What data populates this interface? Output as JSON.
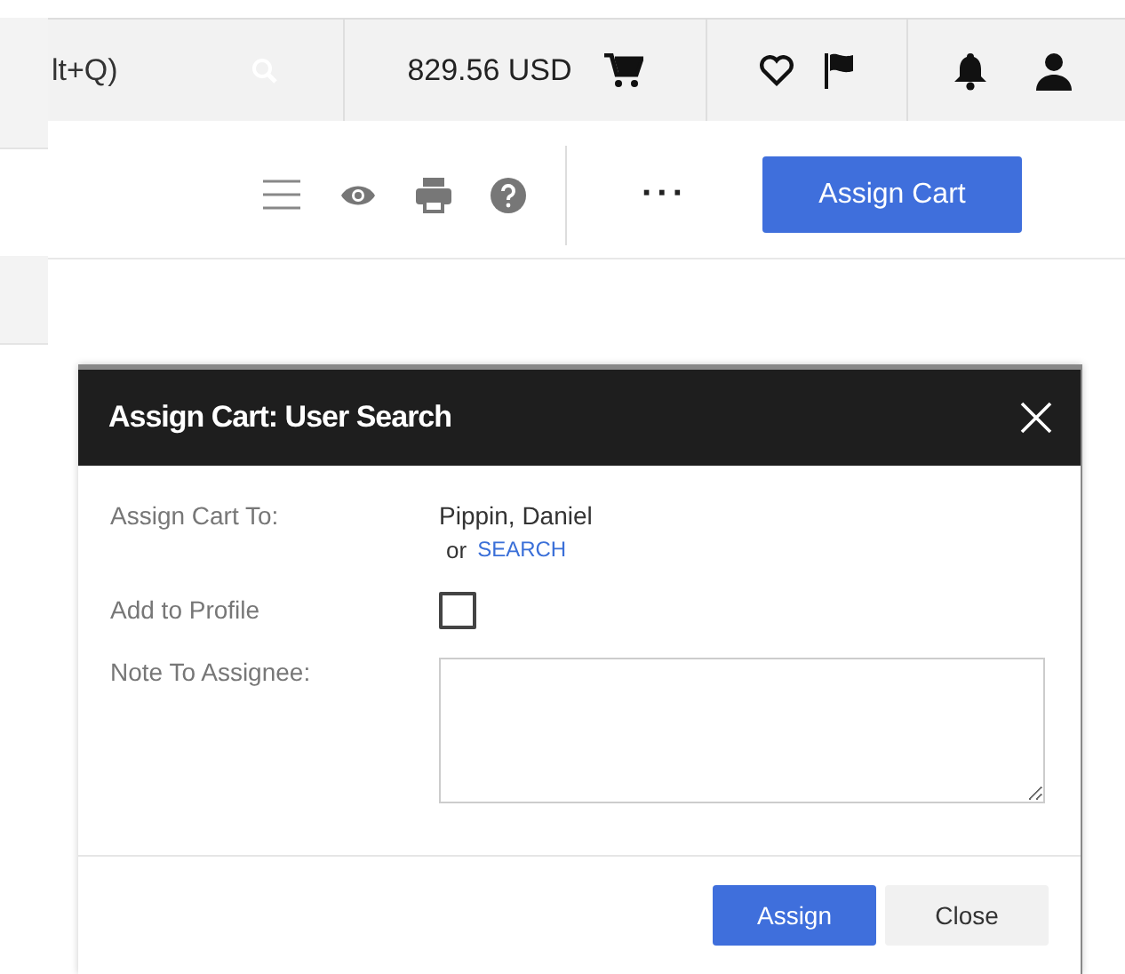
{
  "header": {
    "search_hint": "lt+Q)",
    "cart_total": "829.56 USD"
  },
  "toolbar": {
    "more": "···",
    "assign_button": "Assign Cart"
  },
  "dialog": {
    "title": "Assign Cart: User Search",
    "rows": [
      {
        "kind": "user",
        "label": "Assign Cart To:",
        "value": "Pippin, Daniel",
        "or": "or",
        "link": "SEARCH"
      },
      {
        "kind": "checkbox",
        "label": "Add to Profile",
        "checked": false
      },
      {
        "kind": "note",
        "label": "Note To Assignee:"
      }
    ],
    "buttons": [
      {
        "label": "Assign",
        "primary": true
      },
      {
        "label": "Close",
        "primary": false
      }
    ]
  }
}
